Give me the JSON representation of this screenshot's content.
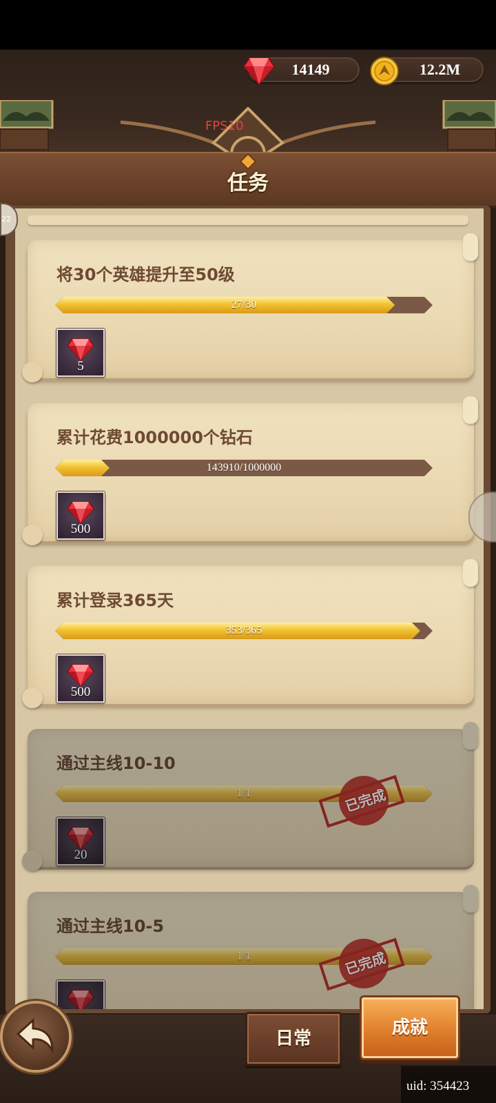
{
  "currency": {
    "gems": "14149",
    "gold": "12.2M",
    "gem_icon": "red-gem-icon",
    "gold_icon": "gold-coin-icon"
  },
  "debug": {
    "fps_label": "FPS10"
  },
  "header": {
    "title": "任务"
  },
  "side_badge": {
    "label": "22"
  },
  "tasks": [
    {
      "title": "将30个英雄提升至50级",
      "progress_text": "27/30",
      "progress": 0.9,
      "reward_icon": "red-gem-icon",
      "reward_amount": "5",
      "completed": false
    },
    {
      "title": "累计花费1000000个钻石",
      "progress_text": "143910/1000000",
      "progress": 0.144,
      "reward_icon": "red-gem-icon",
      "reward_amount": "500",
      "completed": false
    },
    {
      "title": "累计登录365天",
      "progress_text": "353/365",
      "progress": 0.967,
      "reward_icon": "red-gem-icon",
      "reward_amount": "500",
      "completed": false
    },
    {
      "title": "通过主线10-10",
      "progress_text": "1/1",
      "progress": 1.0,
      "reward_icon": "red-gem-icon",
      "reward_amount": "20",
      "completed": true,
      "stamp": "已完成"
    },
    {
      "title": "通过主线10-5",
      "progress_text": "1/1",
      "progress": 1.0,
      "reward_icon": "red-gem-icon",
      "reward_amount": "",
      "completed": true,
      "stamp": "已完成"
    }
  ],
  "tabs": {
    "daily": "日常",
    "achievement": "成就"
  },
  "footer": {
    "uid": "uid: 354423"
  },
  "colors": {
    "accent": "#e07f2c",
    "progress": "#f2c232",
    "stamp": "#d42a24",
    "title_text": "#6e4a33"
  }
}
